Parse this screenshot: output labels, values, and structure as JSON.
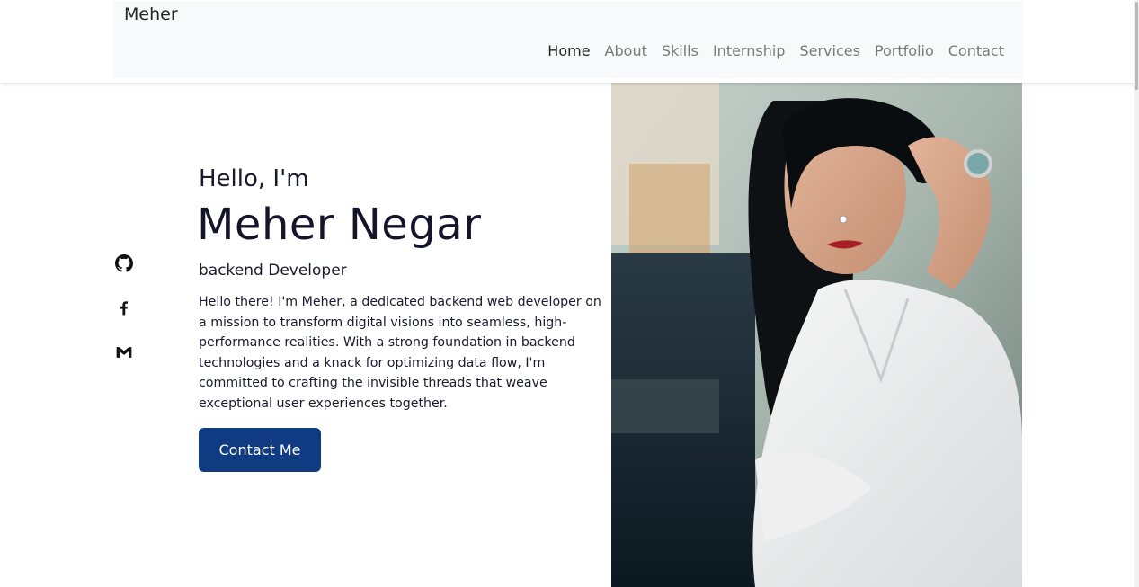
{
  "navbar": {
    "brand": "Meher",
    "links": [
      {
        "label": "Home",
        "active": true
      },
      {
        "label": "About",
        "active": false
      },
      {
        "label": "Skills",
        "active": false
      },
      {
        "label": "Internship",
        "active": false
      },
      {
        "label": "Services",
        "active": false
      },
      {
        "label": "Portfolio",
        "active": false
      },
      {
        "label": "Contact",
        "active": false
      }
    ]
  },
  "social_links": [
    {
      "icon": "github-icon"
    },
    {
      "icon": "facebook-icon"
    },
    {
      "icon": "gmail-icon"
    }
  ],
  "hero": {
    "greeting": "Hello, I'm",
    "name": "Meher Negar",
    "role": "backend Developer",
    "bio": "Hello there! I'm Meher, a dedicated backend web developer on a mission to transform digital visions into seamless, high-performance realities. With a strong foundation in backend technologies and a knack for optimizing data flow, I'm committed to crafting the invisible threads that weave exceptional user experiences together.",
    "cta_label": "Contact Me"
  },
  "colors": {
    "accent": "#0f3b82",
    "text": "#1a1a2e",
    "nav_bg": "#f8f9fa",
    "nav_text": "#7a7a7a"
  }
}
